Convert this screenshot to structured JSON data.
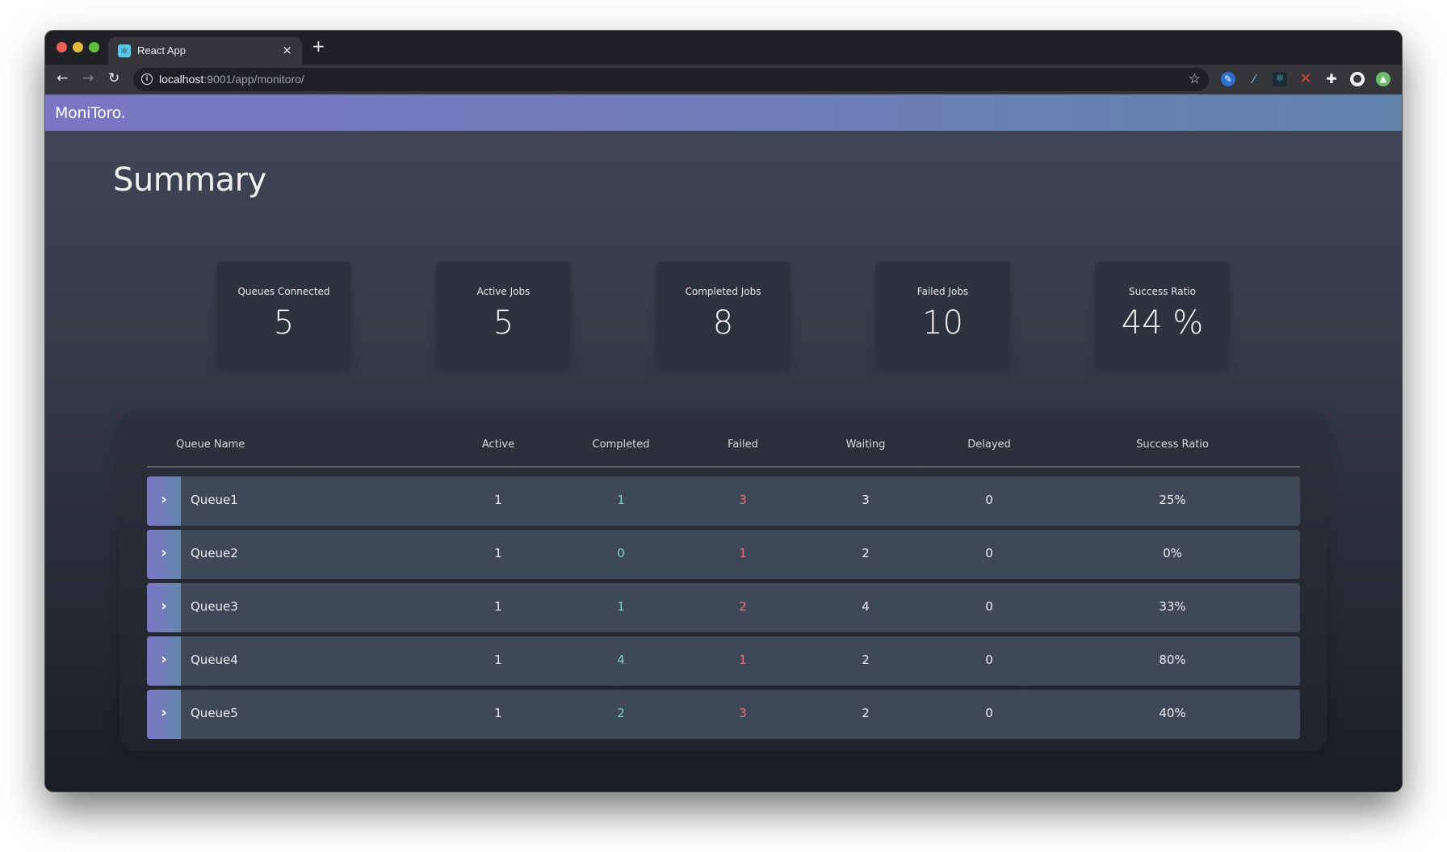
{
  "browser": {
    "tab_title": "React App",
    "tab_favicon": "react-logo-icon",
    "tab_close": "×",
    "new_tab": "+",
    "url_host": "localhost",
    "url_rest": ":9001/app/monitoro/",
    "nav": {
      "back": "←",
      "forward": "→",
      "reload": "↻"
    },
    "icons": {
      "info": "i",
      "star": "☆"
    },
    "extensions": [
      {
        "name": "blue-pen-extension-icon",
        "glyph": "✎"
      },
      {
        "name": "eyedropper-extension-icon",
        "glyph": "⁄"
      },
      {
        "name": "react-devtools-extension-icon",
        "glyph": "⚛"
      },
      {
        "name": "red-x-extension-icon",
        "glyph": "✕"
      },
      {
        "name": "puzzle-extensions-icon",
        "glyph": "✚"
      },
      {
        "name": "profile-avatar-icon",
        "glyph": "●"
      },
      {
        "name": "update-arrow-icon",
        "glyph": "▲"
      }
    ]
  },
  "app": {
    "brand": "MoniToro.",
    "page_title": "Summary"
  },
  "summary_cards": [
    {
      "label": "Queues Connected",
      "value": "5"
    },
    {
      "label": "Active Jobs",
      "value": "5"
    },
    {
      "label": "Completed Jobs",
      "value": "8"
    },
    {
      "label": "Failed Jobs",
      "value": "10"
    },
    {
      "label": "Success Ratio",
      "value": "44 %"
    }
  ],
  "table": {
    "columns": [
      "Queue Name",
      "Active",
      "Completed",
      "Failed",
      "Waiting",
      "Delayed",
      "Success Ratio"
    ],
    "expand_glyph": "›",
    "rows": [
      {
        "name": "Queue1",
        "active": "1",
        "completed": "1",
        "failed": "3",
        "waiting": "3",
        "delayed": "0",
        "success_ratio": "25%"
      },
      {
        "name": "Queue2",
        "active": "1",
        "completed": "0",
        "failed": "1",
        "waiting": "2",
        "delayed": "0",
        "success_ratio": "0%"
      },
      {
        "name": "Queue3",
        "active": "1",
        "completed": "1",
        "failed": "2",
        "waiting": "4",
        "delayed": "0",
        "success_ratio": "33%"
      },
      {
        "name": "Queue4",
        "active": "1",
        "completed": "4",
        "failed": "1",
        "waiting": "2",
        "delayed": "0",
        "success_ratio": "80%"
      },
      {
        "name": "Queue5",
        "active": "1",
        "completed": "2",
        "failed": "3",
        "waiting": "2",
        "delayed": "0",
        "success_ratio": "40%"
      }
    ]
  },
  "colors": {
    "header_gradient_start": "#7a76c4",
    "header_gradient_end": "#6184ab",
    "completed_text": "#7ecfbf",
    "failed_text": "#ef6f74",
    "row_bg": "#3e4859"
  }
}
